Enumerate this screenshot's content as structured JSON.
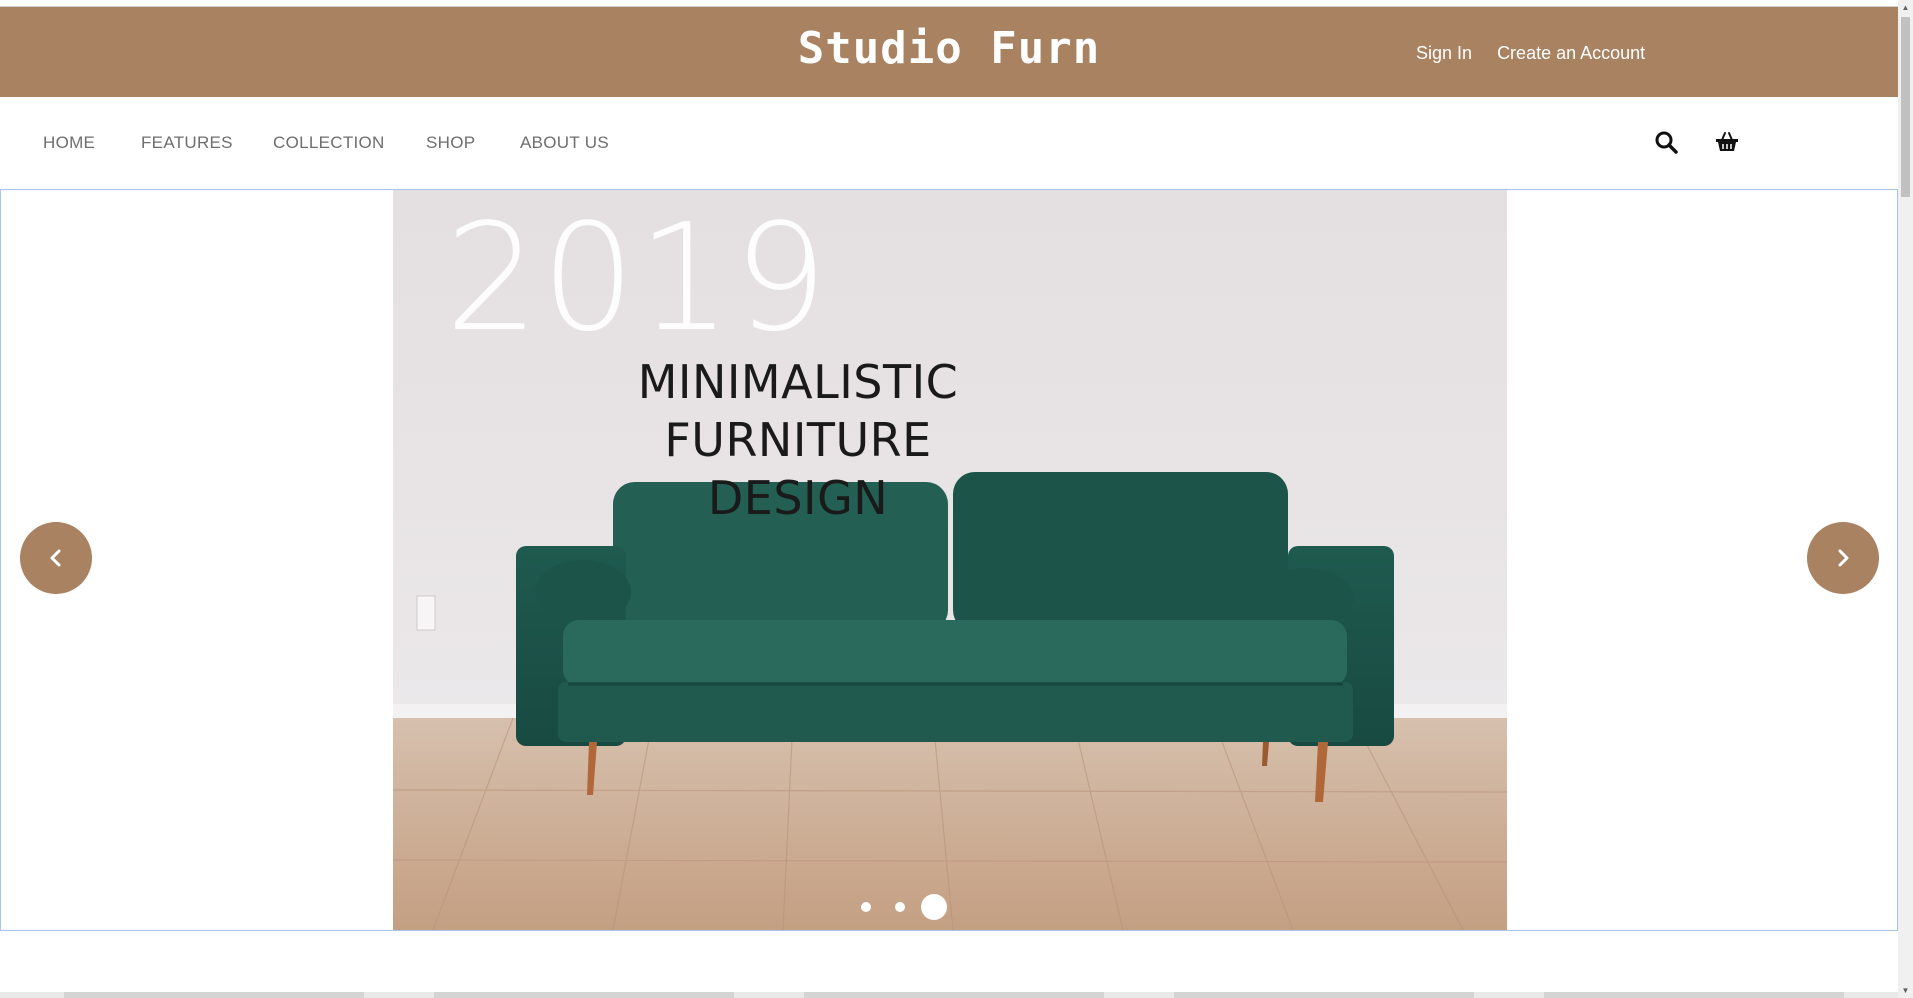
{
  "header": {
    "logo": "Studio Furn",
    "sign_in": "Sign In",
    "create_account": "Create an Account",
    "brand_color": "#a98261"
  },
  "nav": {
    "items": [
      {
        "label": "HOME"
      },
      {
        "label": "FEATURES"
      },
      {
        "label": "COLLECTION"
      },
      {
        "label": "SHOP"
      },
      {
        "label": "ABOUT US"
      }
    ],
    "icons": [
      "search-icon",
      "basket-icon"
    ]
  },
  "hero": {
    "year": "2019",
    "tagline_line1": "MINIMALISTIC FURNITURE",
    "tagline_line2": "DESIGN",
    "sofa_color": "#1f5c50",
    "active_slide": 3,
    "slide_count": 3
  },
  "carousel": {
    "prev_icon": "chevron-left-icon",
    "next_icon": "chevron-right-icon"
  }
}
